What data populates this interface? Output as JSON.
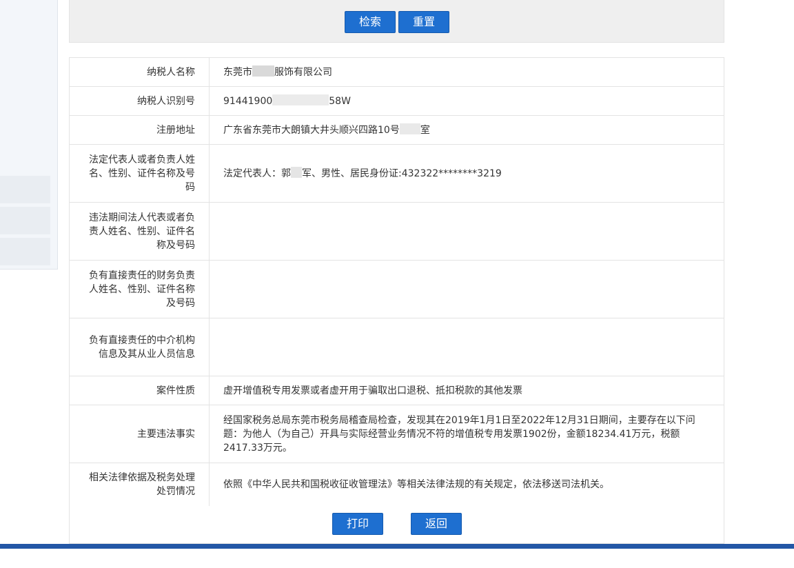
{
  "search": {
    "search_label": "检索",
    "reset_label": "重置"
  },
  "details": {
    "taxpayer_name": {
      "label": "纳税人名称",
      "prefix": "东莞市",
      "suffix": "服饰有限公司"
    },
    "taxpayer_id": {
      "label": "纳税人识别号",
      "prefix": "91441900",
      "suffix": "58W"
    },
    "address": {
      "label": "注册地址",
      "prefix": "广东省东莞市大朗镇大井头顺兴四路10号",
      "suffix": "室"
    },
    "legal_rep": {
      "label": "法定代表人或者负责人姓名、性别、证件名称及号码",
      "prefix": "法定代表人：郭",
      "suffix": "军、男性、居民身份证:432322********3219"
    },
    "violation_period_rep": {
      "label": "违法期间法人代表或者负责人姓名、性别、证件名称及号码",
      "value": ""
    },
    "finance_person": {
      "label": "负有直接责任的财务负责人姓名、性别、证件名称及号码",
      "value": ""
    },
    "intermediary": {
      "label": "负有直接责任的中介机构信息及其从业人员信息",
      "value": ""
    },
    "case_nature": {
      "label": "案件性质",
      "value": "虚开增值税专用发票或者虚开用于骗取出口退税、抵扣税款的其他发票"
    },
    "main_facts": {
      "label": "主要违法事实",
      "value": "经国家税务总局东莞市税务局稽查局检查，发现其在2019年1月1日至2022年12月31日期间，主要存在以下问题：为他人（为自己）开具与实际经营业务情况不符的增值税专用发票1902份，金额18234.41万元，税额2417.33万元。"
    },
    "legal_basis": {
      "label": "相关法律依据及税务处理处罚情况",
      "value": "依照《中华人民共和国税收征收管理法》等相关法律法规的有关规定，依法移送司法机关。"
    }
  },
  "footer": {
    "print_label": "打印",
    "back_label": "返回"
  },
  "colors": {
    "primary_button": "#1e6fd0",
    "bottom_bar": "#2357a6",
    "border": "#e3e3e3"
  }
}
